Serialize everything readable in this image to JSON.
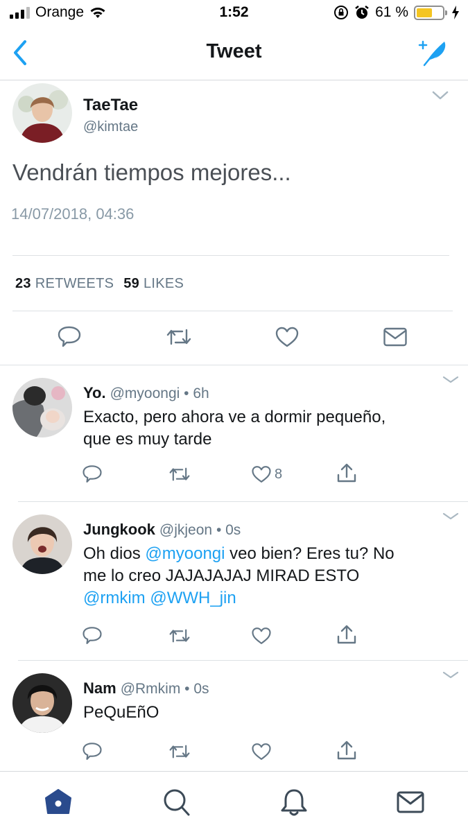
{
  "status_bar": {
    "carrier": "Orange",
    "time": "1:52",
    "battery_percent": "61 %",
    "battery_level": 0.61,
    "icons": [
      "signal-icon",
      "wifi-icon",
      "rotation-lock-icon",
      "alarm-icon",
      "battery-icon",
      "charging-icon"
    ]
  },
  "nav": {
    "title": "Tweet",
    "back_icon": "chevron-left-icon",
    "compose_icon": "compose-feather-icon"
  },
  "main_tweet": {
    "name": "TaeTae",
    "handle": "@kimtae",
    "text": "Vendrán tiempos mejores...",
    "date": "14/07/2018, 04:36",
    "retweets_count": "23",
    "retweets_label": "RETWEETS",
    "likes_count": "59",
    "likes_label": "LIKES"
  },
  "replies": [
    {
      "name": "Yo.",
      "handle": "@myoongi",
      "time": "• 6h",
      "line1": "Exacto, pero ahora ve a dormir pequeño,",
      "line2": "que es muy tarde",
      "like_count": "8"
    },
    {
      "name": "Jungkook",
      "handle": "@jkjeon",
      "time": "• 0s",
      "line1_prefix": "Oh dios ",
      "line1_mention": "@myoongi",
      "line1_suffix": " veo bien? Eres tu? No",
      "line2": "me lo creo JAJAJAJAJ MIRAD ESTO",
      "line3_mention1": "@rmkim",
      "line3_mention2": "@WWH_jin",
      "like_count": ""
    },
    {
      "name": "Nam",
      "handle": "@Rmkim",
      "time": "• 0s",
      "line1": "PeQuEñO",
      "like_count": ""
    }
  ],
  "colors": {
    "accent": "#1da1f2",
    "icon_gray": "#657786",
    "tab_active": "#2a4b8d",
    "tab_inactive": "#3c4a57"
  },
  "tabs": [
    "home-icon",
    "search-icon",
    "notifications-bell-icon",
    "messages-envelope-icon"
  ]
}
